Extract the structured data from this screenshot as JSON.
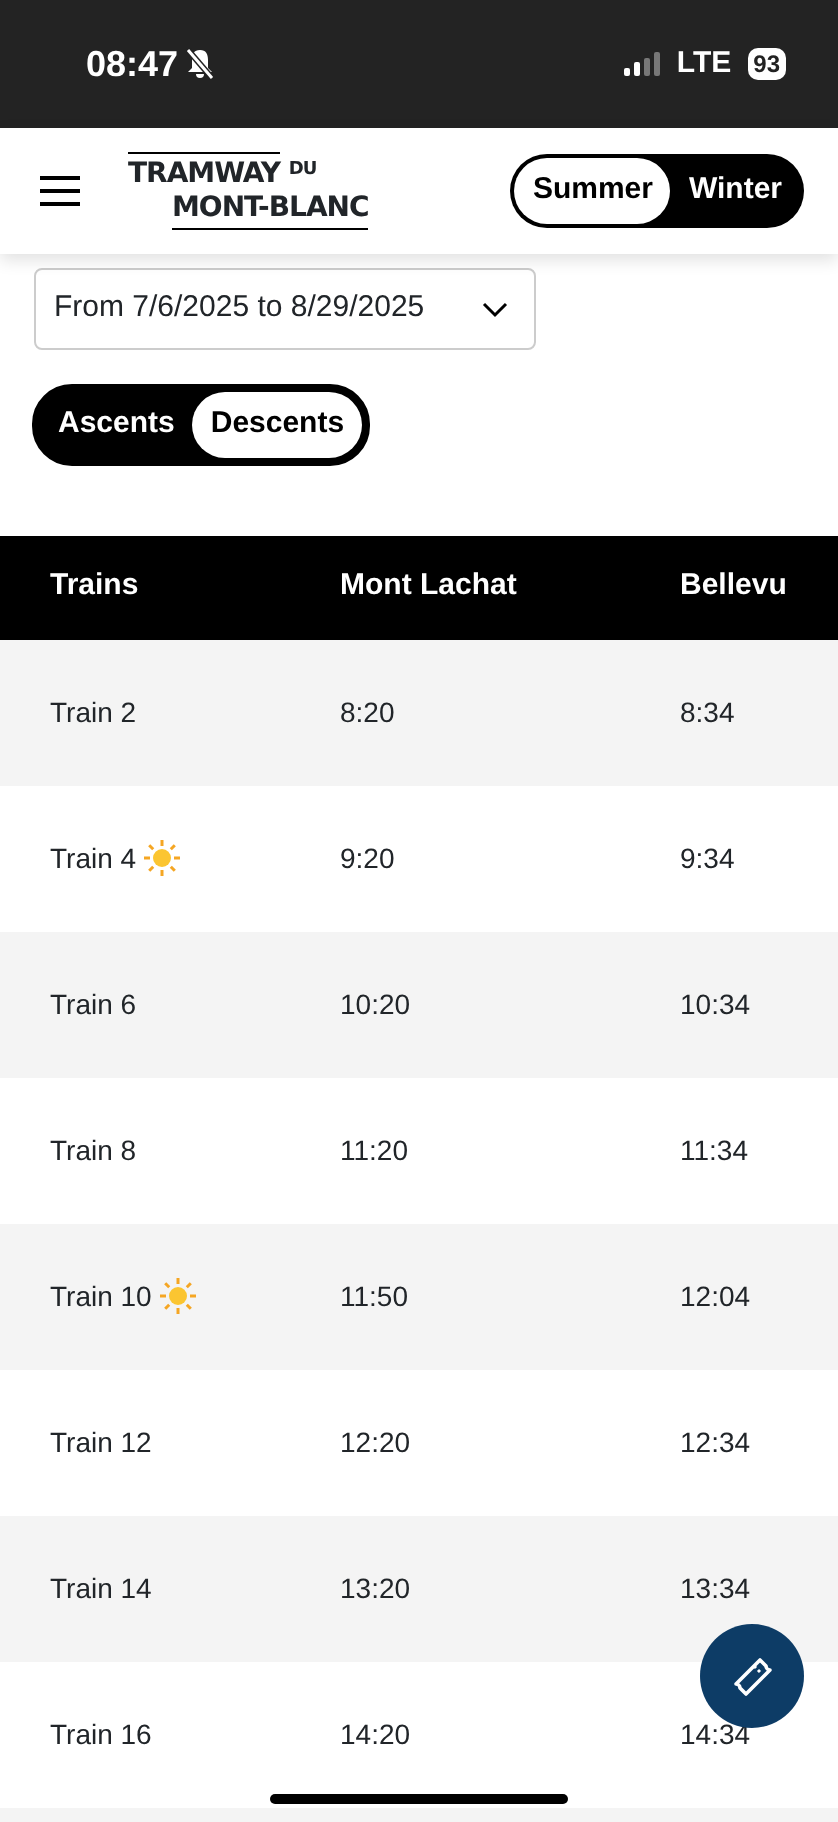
{
  "status_bar": {
    "time": "08:47",
    "network": "LTE",
    "battery": "93"
  },
  "header": {
    "logo_line_1": "TRAMWAY",
    "logo_sup": "DU",
    "logo_line_2": "MONT-BLANC",
    "season_toggle": [
      {
        "label": "Summer",
        "selected": true
      },
      {
        "label": "Winter",
        "selected": false
      }
    ]
  },
  "date_range": {
    "value": "From 7/6/2025 to 8/29/2025"
  },
  "direction_toggle": [
    {
      "label": "Ascents",
      "selected": false
    },
    {
      "label": "Descents",
      "selected": true
    }
  ],
  "table": {
    "columns": [
      "Trains",
      "Mont Lachat",
      "Bellevu"
    ],
    "rows": [
      {
        "train": "Train 2",
        "sun": false,
        "times": [
          "8:20",
          "8:34"
        ]
      },
      {
        "train": "Train 4",
        "sun": true,
        "times": [
          "9:20",
          "9:34"
        ]
      },
      {
        "train": "Train 6",
        "sun": false,
        "times": [
          "10:20",
          "10:34"
        ]
      },
      {
        "train": "Train 8",
        "sun": false,
        "times": [
          "11:20",
          "11:34"
        ]
      },
      {
        "train": "Train 10",
        "sun": true,
        "times": [
          "11:50",
          "12:04"
        ]
      },
      {
        "train": "Train 12",
        "sun": false,
        "times": [
          "12:20",
          "12:34"
        ]
      },
      {
        "train": "Train 14",
        "sun": false,
        "times": [
          "13:20",
          "13:34"
        ]
      },
      {
        "train": "Train 16",
        "sun": false,
        "times": [
          "14:20",
          "14:34"
        ]
      }
    ]
  }
}
